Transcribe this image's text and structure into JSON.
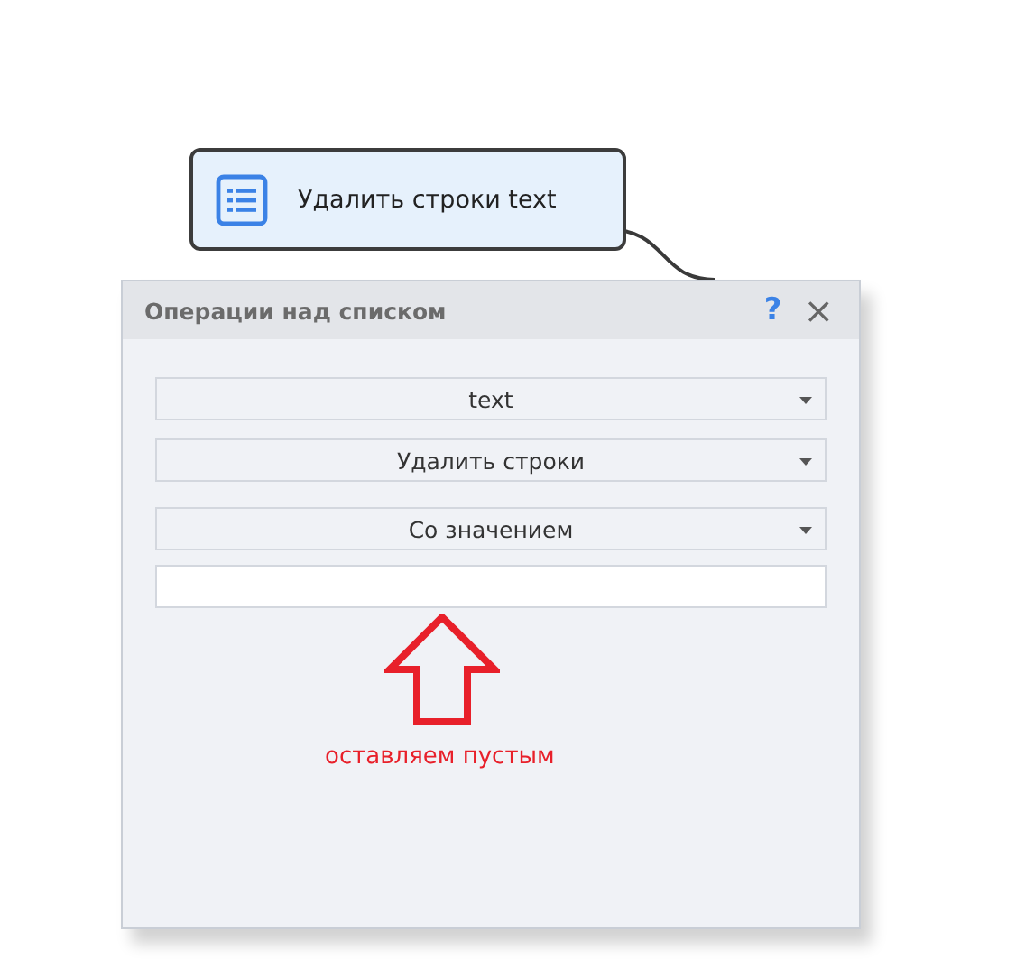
{
  "node": {
    "label": "Удалить строки text"
  },
  "dialog": {
    "title": "Операции над списком",
    "help": "?",
    "close": "×",
    "dropdowns": [
      {
        "value": "text"
      },
      {
        "value": "Удалить строки"
      },
      {
        "value": "Со значением"
      }
    ],
    "annotation": "оставляем пустым"
  }
}
